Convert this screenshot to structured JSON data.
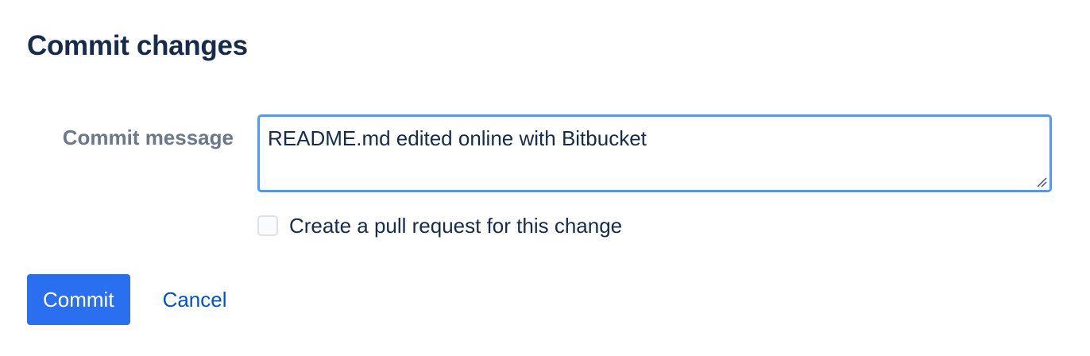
{
  "dialog": {
    "title": "Commit changes"
  },
  "commit_message": {
    "label": "Commit message",
    "value": "README.md edited online with Bitbucket"
  },
  "pull_request": {
    "label": "Create a pull request for this change",
    "checked": false
  },
  "actions": {
    "commit_label": "Commit",
    "cancel_label": "Cancel"
  },
  "colors": {
    "primary_button": "#2a6ff0",
    "link": "#0052cc",
    "focus_border": "#4c9aff",
    "heading_text": "#172b4d",
    "label_text": "#6b778c"
  },
  "icons": {
    "resize": "resize-handle-icon"
  }
}
